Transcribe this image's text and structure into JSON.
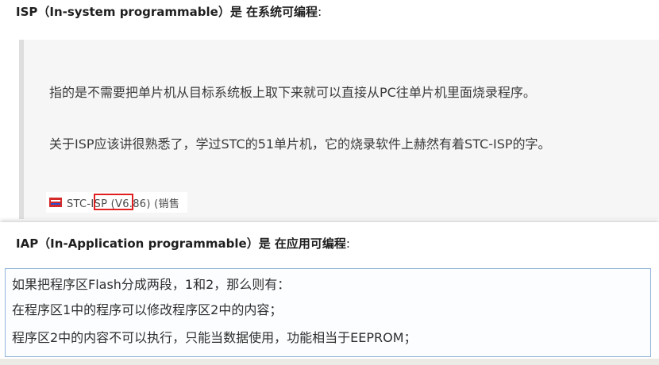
{
  "isp": {
    "title": "ISP（In-system programmable）是 在系统可编程",
    "colon": ":",
    "para1": "指的是不需要把单片机从目标系统板上取下来就可以直接从PC往单片机里面烧录程序。",
    "para2": "关于ISP应该讲很熟悉了，学过STC的51单片机，它的烧录软件上赫然有着STC-ISP的字。"
  },
  "stc_window": {
    "title": "STC-ISP (V6.86) (销售"
  },
  "iap": {
    "title": "IAP（In-Application programmable）是 在应用可编程",
    "colon": ":",
    "lines": [
      "如果把程序区Flash分成两段，1和2，那么则有：",
      "在程序区1中的程序可以修改程序区2中的内容；",
      "程序区2中的内容不可以执行，只能当数据使用，功能相当于EEPROM；"
    ]
  }
}
